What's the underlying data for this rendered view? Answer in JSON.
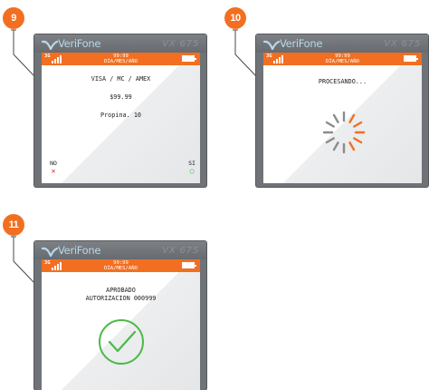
{
  "brand_colors": {
    "accent": "#f26f21",
    "success": "#4cb848",
    "cancel": "#e0202a",
    "spinner_gray": "#8c8c8c"
  },
  "icons": [
    "verifone-logo-icon",
    "signal-icon",
    "battery-icon",
    "spinner-icon",
    "check-circle-icon",
    "cancel-x-icon",
    "ok-circle-icon"
  ],
  "screens": [
    {
      "step": "9",
      "brand": "VeriFone",
      "model": "VX 675",
      "status": {
        "network": "3G",
        "time": "99:99",
        "date": "DÍA/MES/AÑO"
      },
      "lines": [
        "VISA / MC / AMEX",
        "$99.99",
        "Propina. 10"
      ],
      "left_key": "NO",
      "left_mark": "✕",
      "right_key": "SI",
      "right_mark": "○"
    },
    {
      "step": "10",
      "brand": "VeriFone",
      "model": "VX 675",
      "status": {
        "network": "3G",
        "time": "99:99",
        "date": "DÍA/MES/AÑO"
      },
      "lines": [
        "PROCESANDO..."
      ]
    },
    {
      "step": "11",
      "brand": "VeriFone",
      "model": "VX 675",
      "status": {
        "network": "3G",
        "time": "99:99",
        "date": "DÍA/MES/AÑO"
      },
      "lines": [
        "APROBADO",
        "AUTORIZACION 000999"
      ]
    }
  ]
}
